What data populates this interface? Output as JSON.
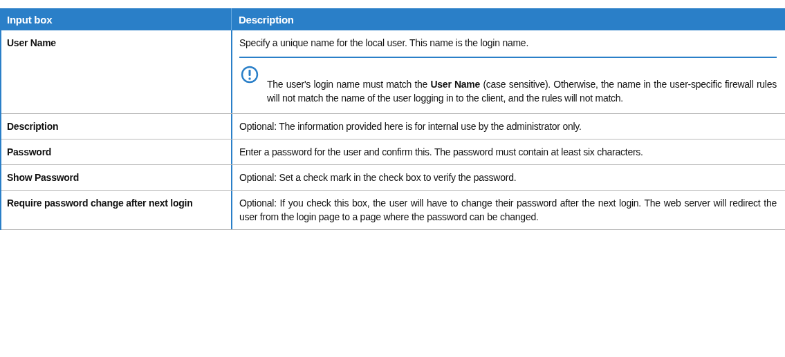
{
  "table": {
    "columns": [
      "Input box",
      "Description"
    ],
    "rows": [
      {
        "label": "User Name",
        "description": "Specify a unique name for the local user. This name is the login name.",
        "note": "The user's login name must match the **User Name** (case sensitive). Otherwise, the name in the user-specific firewall rules will not match the name of the user logging in to the client, and the rules will not match."
      },
      {
        "label": "Description",
        "description": "Optional: The information provided here is for internal use by the administrator only."
      },
      {
        "label": "Password",
        "description": "Enter a password for the user and confirm this. The password must contain at least six characters."
      },
      {
        "label": "Show Password",
        "description": "Optional: Set a check mark in the check box to verify the password."
      },
      {
        "label": "Require password change after next login",
        "description": "Optional: If you check this box, the user will have to change their password after the next login. The web server will redirect the user from the login page to a page where the password can be changed."
      }
    ]
  }
}
